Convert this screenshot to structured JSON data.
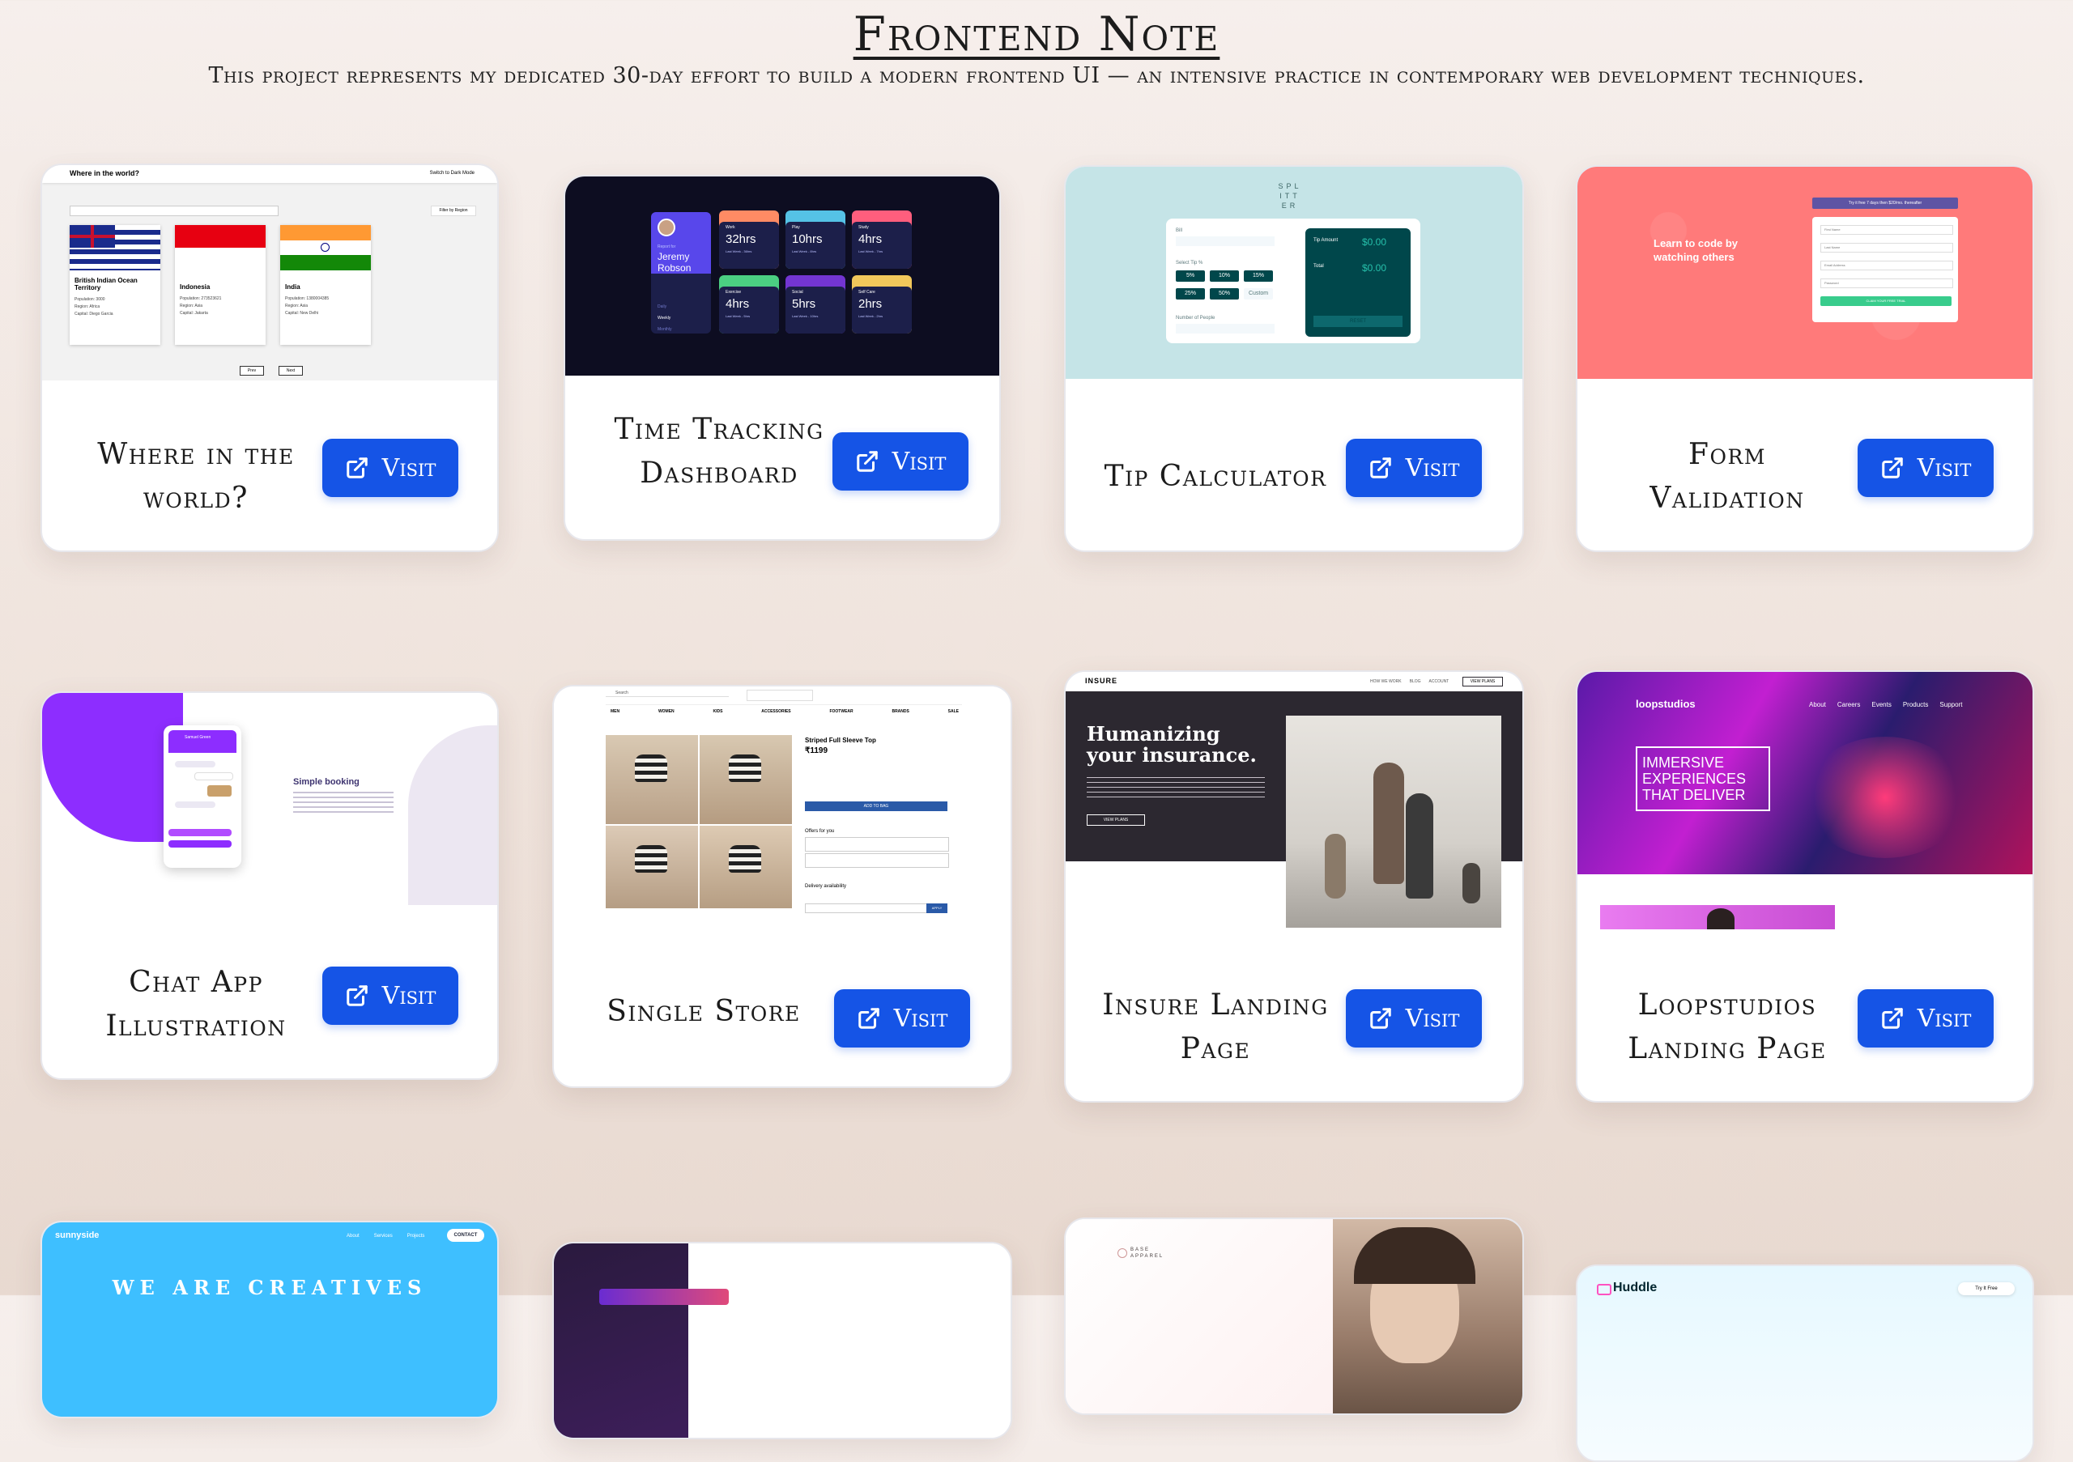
{
  "header": {
    "title": "Frontend Note",
    "subtitle": "This project represents my dedicated 30-day effort to build a modern frontend UI — an intensive practice in contemporary web development techniques."
  },
  "visit_label": "Visit",
  "projects": [
    {
      "title": "Where in the world?",
      "thumb": {
        "app_title": "Where in the world?",
        "dark_mode": "Switch to Dark Mode",
        "filter": "Filter by Region",
        "countries": [
          "British Indian Ocean Territory",
          "Indonesia",
          "India"
        ],
        "prev": "Prev",
        "next": "Next"
      }
    },
    {
      "title": "Time Tracking Dashboard",
      "thumb": {
        "report_for": "Report for",
        "name": "Jeremy Robson",
        "periods": [
          "Daily",
          "Weekly",
          "Monthly"
        ],
        "tiles": [
          {
            "label": "Work",
            "value": "32hrs"
          },
          {
            "label": "Play",
            "value": "10hrs"
          },
          {
            "label": "Study",
            "value": "4hrs"
          },
          {
            "label": "Exercise",
            "value": "4hrs"
          },
          {
            "label": "Social",
            "value": "5hrs"
          },
          {
            "label": "Self Care",
            "value": "2hrs"
          }
        ]
      }
    },
    {
      "title": "Tip Calculator",
      "thumb": {
        "logo": "SPLITTER",
        "bill": "Bill",
        "select_tip": "Select Tip %",
        "tips": [
          "5%",
          "10%",
          "15%",
          "25%",
          "50%",
          "Custom"
        ],
        "people": "Number of People",
        "tip_amount": "Tip Amount",
        "total": "Total",
        "amount": "$0.00",
        "reset": "RESET"
      }
    },
    {
      "title": "Form Validation",
      "thumb": {
        "headline": "Learn to code by watching others",
        "banner": "Try it free 7 days then $20/mo. thereafter",
        "fields": [
          "First Name",
          "Last Name",
          "Email Address",
          "Password"
        ],
        "cta": "CLAIM YOUR FREE TRIAL"
      }
    },
    {
      "title": "Chat App Illustration",
      "thumb": {
        "heading": "Simple booking",
        "contact": "Samuel Green"
      }
    },
    {
      "title": "Single Store",
      "thumb": {
        "search": "Search",
        "nav": [
          "MEN",
          "WOMEN",
          "KIDS",
          "ACCESSORIES",
          "FOOTWEAR",
          "BRANDS",
          "SALE"
        ],
        "product": "Striped Full Sleeve Top",
        "price": "₹1199",
        "add": "ADD TO BAG",
        "offers": "Offers for you",
        "delivery": "Delivery availability",
        "apply": "APPLY"
      }
    },
    {
      "title": "Insure Landing Page",
      "thumb": {
        "logo": "INSURE",
        "nav": [
          "HOW WE WORK",
          "BLOG",
          "ACCOUNT"
        ],
        "nav_cta": "VIEW PLANS",
        "headline": "Humanizing your insurance.",
        "cta": "VIEW PLANS"
      }
    },
    {
      "title": "Loopstudios Landing Page",
      "thumb": {
        "logo": "loopstudios",
        "nav": [
          "About",
          "Careers",
          "Events",
          "Products",
          "Support"
        ],
        "headline": "IMMERSIVE EXPERIENCES THAT DELIVER"
      }
    },
    {
      "title": "",
      "thumb": {
        "logo": "sunnyside",
        "nav": [
          "About",
          "Services",
          "Projects"
        ],
        "nav_cta": "CONTACT",
        "headline": "WE ARE CREATIVES"
      }
    },
    {
      "title": "",
      "thumb": {}
    },
    {
      "title": "",
      "thumb": {
        "logo": "BASE APPAREL"
      }
    },
    {
      "title": "",
      "thumb": {
        "logo": "Huddle",
        "nav_cta": "Try It Free"
      }
    }
  ],
  "colors": {
    "accent": "#1554e6",
    "dark_navy": "#0d0d21",
    "teal": "#c5e4e7",
    "coral": "#ff7a7a",
    "purple": "#7b2ff7"
  }
}
